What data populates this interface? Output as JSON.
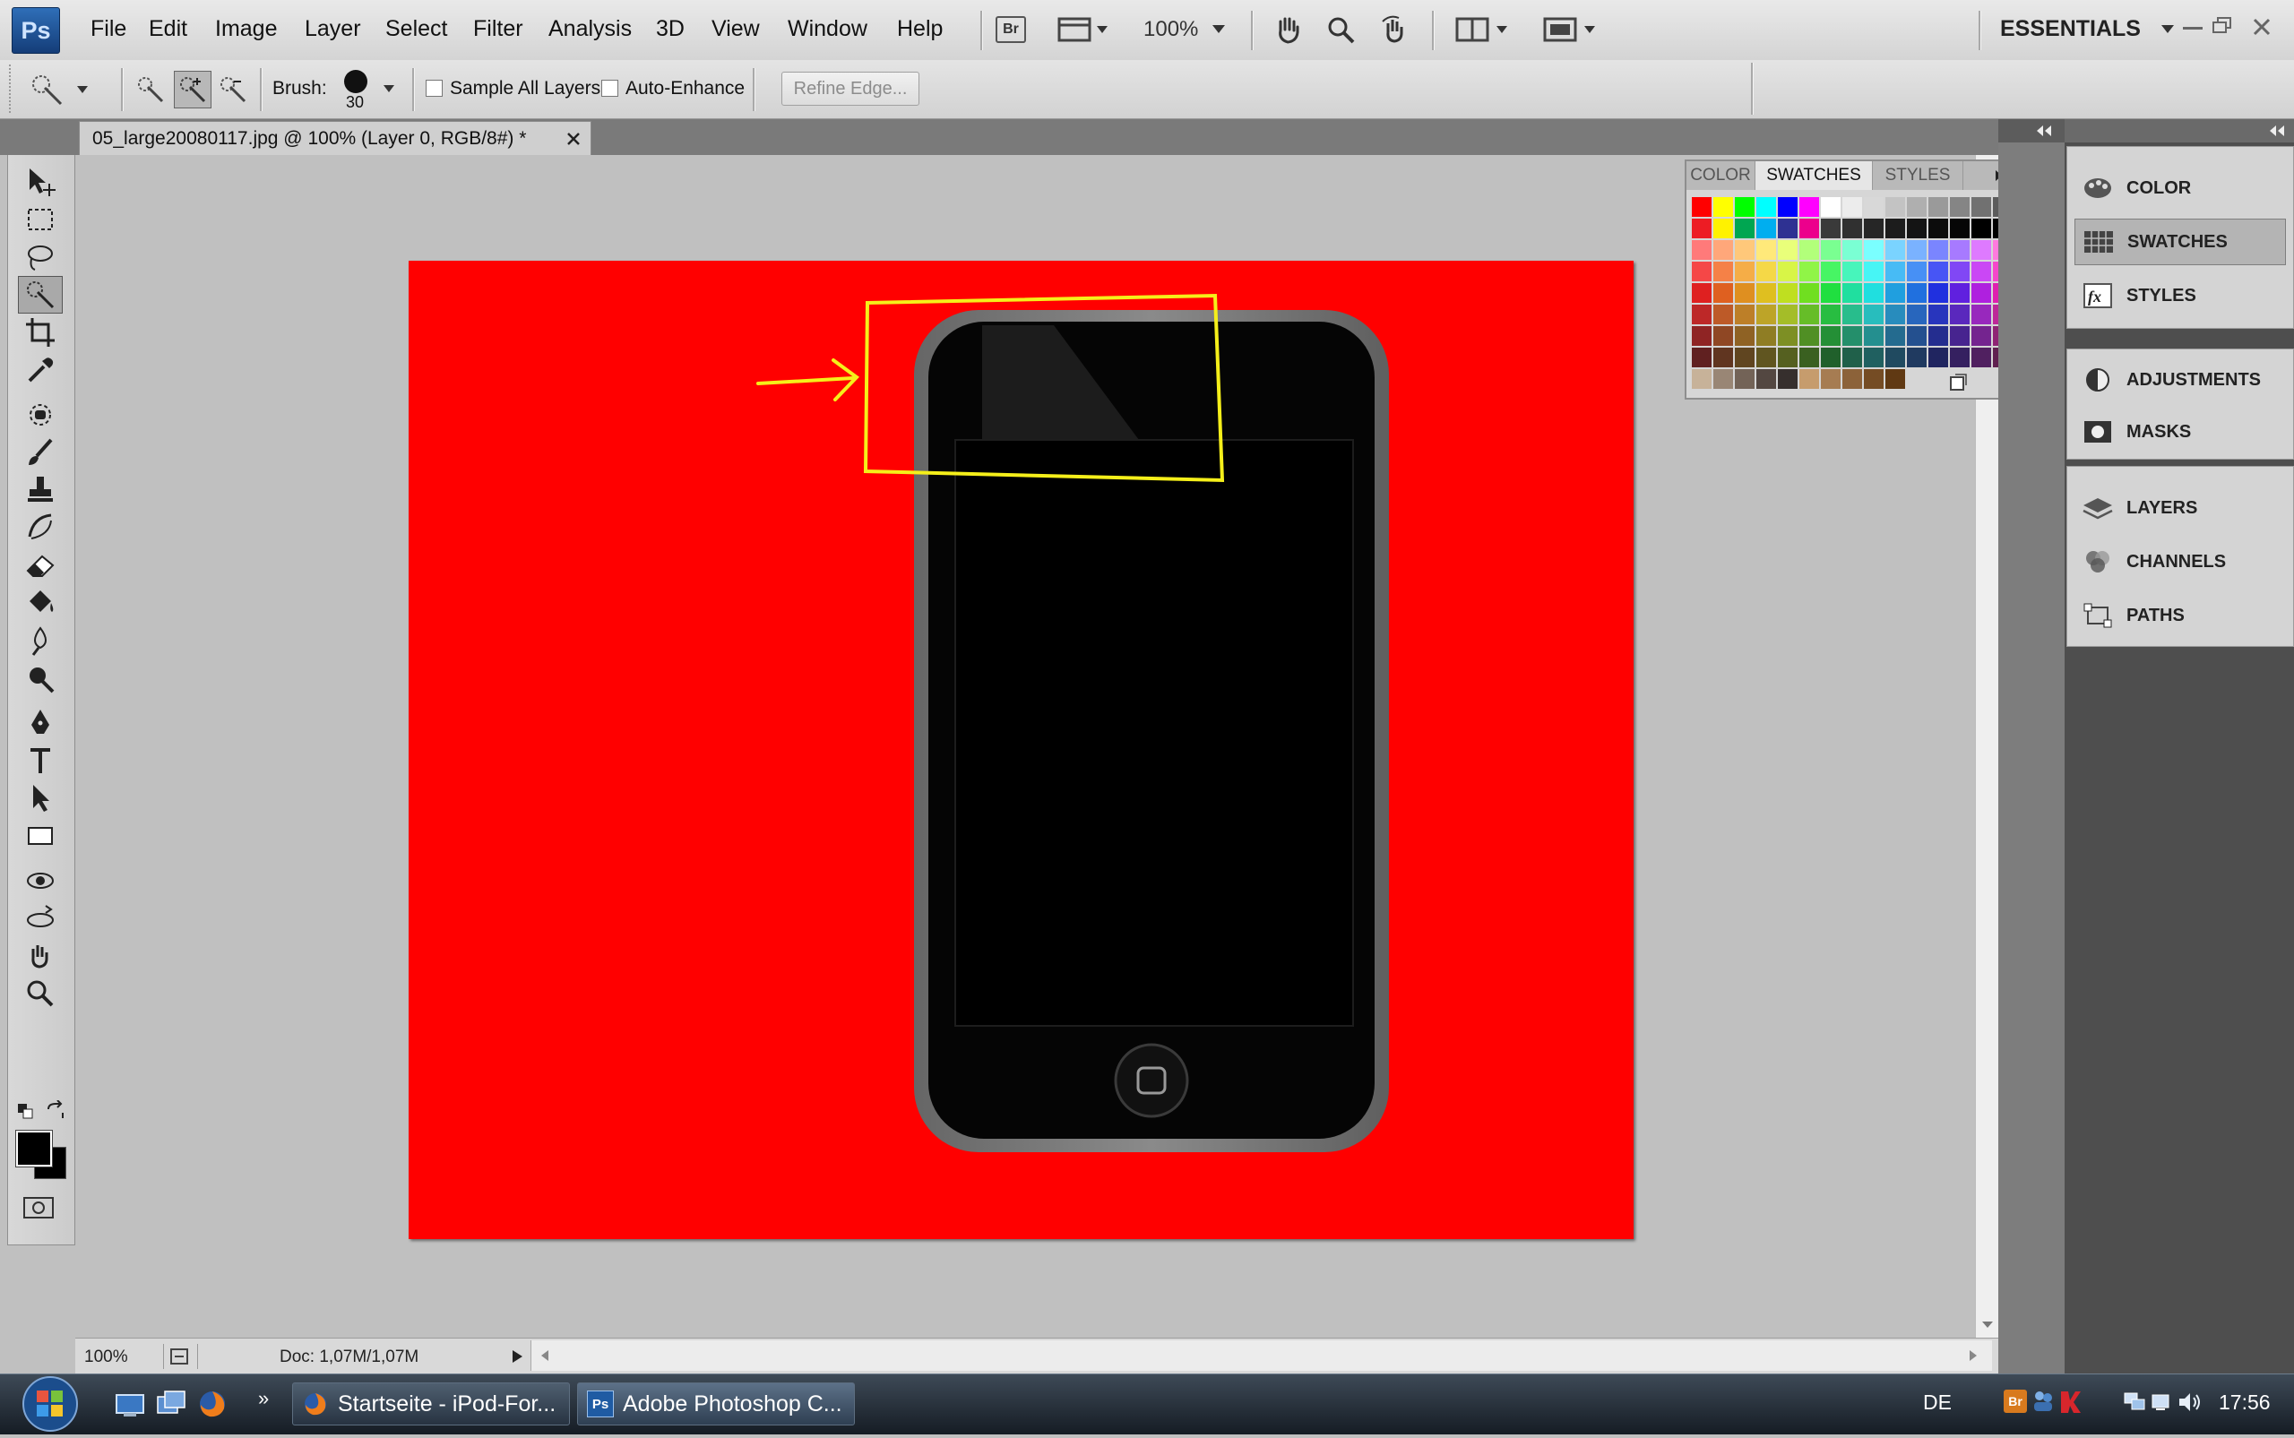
{
  "app": {
    "logo": "Ps",
    "workspace": "ESSENTIALS",
    "zoom": "100%",
    "bridge_label": "Br"
  },
  "menu": [
    "File",
    "Edit",
    "Image",
    "Layer",
    "Select",
    "Filter",
    "Analysis",
    "3D",
    "View",
    "Window",
    "Help"
  ],
  "options_bar": {
    "brush_label": "Brush:",
    "brush_size": "30",
    "sample_all_layers": "Sample All Layers",
    "auto_enhance": "Auto-Enhance",
    "refine_edge": "Refine Edge..."
  },
  "document": {
    "tab_title": "05_large20080117.jpg @ 100% (Layer 0, RGB/8#) *",
    "background_color": "#ff0000"
  },
  "status_bar": {
    "zoom": "100%",
    "doc_info": "Doc: 1,07M/1,07M"
  },
  "swatches_panel": {
    "tabs": [
      "COLOR",
      "SWATCHES",
      "STYLES"
    ],
    "active_tab": "SWATCHES"
  },
  "dock": {
    "group1": [
      "COLOR",
      "SWATCHES",
      "STYLES"
    ],
    "group2": [
      "ADJUSTMENTS",
      "MASKS"
    ],
    "group3": [
      "LAYERS",
      "CHANNELS",
      "PATHS"
    ],
    "active": "SWATCHES"
  },
  "taskbar": {
    "tasks": [
      "Startseite - iPod-For...",
      "Adobe Photoshop C..."
    ],
    "language": "DE",
    "clock": "17:56"
  },
  "annotation": {
    "color": "#f5ef1a"
  }
}
